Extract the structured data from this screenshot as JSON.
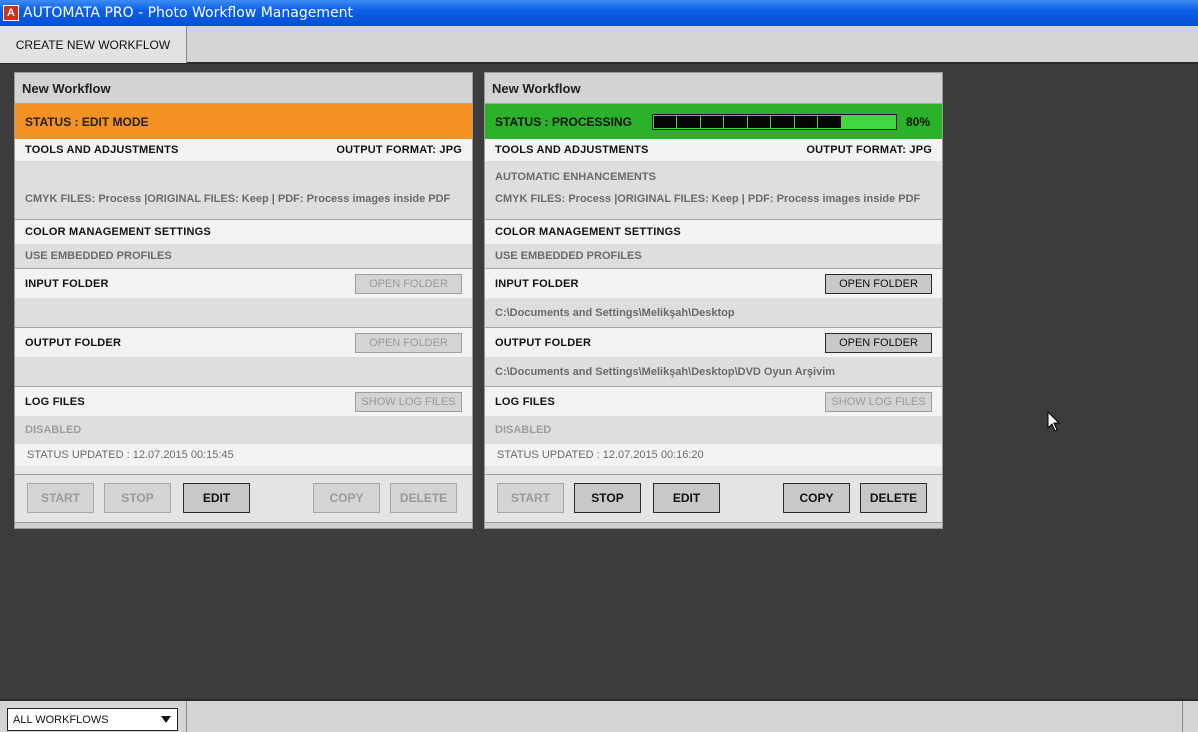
{
  "window": {
    "title": "AUTOMATA PRO - Photo Workflow Management",
    "icon": "app-logo-icon"
  },
  "toolbar": {
    "create_label": "CREATE NEW WORKFLOW"
  },
  "workflows": [
    {
      "title": "New Workflow",
      "status": "STATUS : EDIT MODE",
      "status_color": "#f39122",
      "tools_label": "TOOLS AND ADJUSTMENTS",
      "output_format": "OUTPUT FORMAT: JPG",
      "enhancements": "",
      "files_info": "CMYK FILES: Process |ORIGINAL FILES: Keep | PDF: Process images inside PDF",
      "color_label": "COLOR MANAGEMENT SETTINGS",
      "color_value": "USE EMBEDDED PROFILES",
      "input_label": "INPUT FOLDER",
      "input_path": "",
      "output_label": "OUTPUT FOLDER",
      "output_path": "",
      "open_folder_label": "OPEN FOLDER",
      "log_label": "LOG FILES",
      "show_log_label": "SHOW LOG FILES",
      "log_value": "DISABLED",
      "updated": "STATUS UPDATED : 12.07.2015 00:15:45",
      "buttons": {
        "start": "START",
        "stop": "STOP",
        "edit": "EDIT",
        "copy": "COPY",
        "delete": "DELETE"
      }
    },
    {
      "title": "New Workflow",
      "status": "STATUS : PROCESSING",
      "status_color": "#2ab22a",
      "progress": 0.8,
      "progress_label": "80%",
      "tools_label": "TOOLS AND ADJUSTMENTS",
      "output_format": "OUTPUT FORMAT: JPG",
      "enhancements": "AUTOMATIC ENHANCEMENTS",
      "files_info": "CMYK FILES: Process |ORIGINAL FILES: Keep | PDF: Process images inside PDF",
      "color_label": "COLOR MANAGEMENT SETTINGS",
      "color_value": "USE EMBEDDED PROFILES",
      "input_label": "INPUT FOLDER",
      "input_path": "C:\\Documents and Settings\\Melikşah\\Desktop",
      "output_label": "OUTPUT FOLDER",
      "output_path": "C:\\Documents and Settings\\Melikşah\\Desktop\\DVD Oyun Arşivim",
      "open_folder_label": "OPEN FOLDER",
      "log_label": "LOG FILES",
      "show_log_label": "SHOW LOG FILES",
      "log_value": "DISABLED",
      "updated": "STATUS UPDATED : 12.07.2015 00:16:20",
      "buttons": {
        "start": "START",
        "stop": "STOP",
        "edit": "EDIT",
        "copy": "COPY",
        "delete": "DELETE"
      }
    }
  ],
  "statusbar": {
    "filter_value": "ALL WORKFLOWS"
  }
}
